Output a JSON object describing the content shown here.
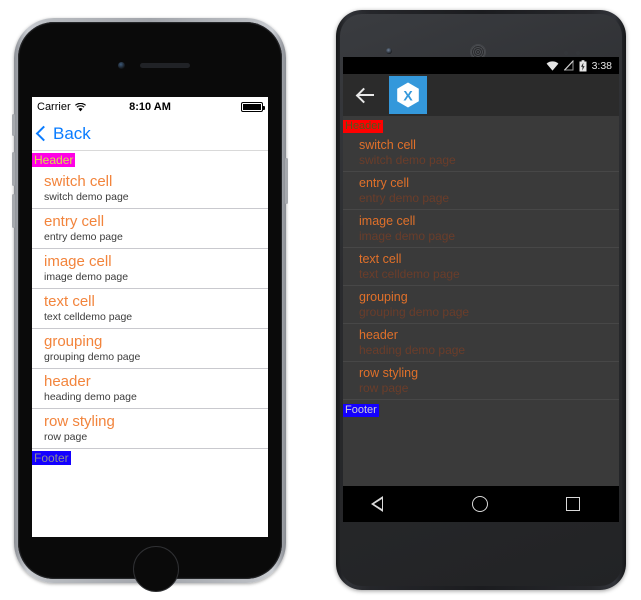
{
  "ios": {
    "status": {
      "carrier": "Carrier",
      "wifi_icon": "wifi-icon",
      "time": "8:10 AM",
      "battery_icon": "battery-icon"
    },
    "nav": {
      "back_label": "Back",
      "back_chevron_icon": "chevron-left-icon"
    },
    "list": {
      "header_label": "Header",
      "footer_label": "Footer",
      "rows": [
        {
          "title": "switch cell",
          "subtitle": "switch demo page"
        },
        {
          "title": "entry cell",
          "subtitle": "entry demo page"
        },
        {
          "title": "image cell",
          "subtitle": "image demo page"
        },
        {
          "title": "text cell",
          "subtitle": "text celldemo page"
        },
        {
          "title": "grouping",
          "subtitle": "grouping demo page"
        },
        {
          "title": "header",
          "subtitle": "heading demo page"
        },
        {
          "title": "row styling",
          "subtitle": "row page"
        }
      ]
    },
    "colors": {
      "header_bg": "#ff00e6",
      "header_text": "#d9e04a",
      "footer_bg": "#1400ff",
      "footer_text": "#8e8e93",
      "title": "#f2843c",
      "tint": "#0a7cff"
    }
  },
  "android": {
    "status": {
      "wifi_icon": "wifi-icon",
      "signal_off_icon": "signal-off-icon",
      "battery_icon": "battery-charging-icon",
      "time": "3:38"
    },
    "actionbar": {
      "back_icon": "arrow-left-icon",
      "logo_icon": "xamarin-logo-icon",
      "logo_letter": "X"
    },
    "list": {
      "header_label": "Header",
      "footer_label": "Footer",
      "rows": [
        {
          "title": "switch cell",
          "subtitle": "switch demo page"
        },
        {
          "title": "entry cell",
          "subtitle": "entry demo page"
        },
        {
          "title": "image cell",
          "subtitle": "image demo page"
        },
        {
          "title": "text cell",
          "subtitle": "text celldemo page"
        },
        {
          "title": "grouping",
          "subtitle": "grouping demo page"
        },
        {
          "title": "header",
          "subtitle": "heading demo page"
        },
        {
          "title": "row styling",
          "subtitle": "row page"
        }
      ]
    },
    "navbar": {
      "back_icon": "nav-back-icon",
      "home_icon": "nav-home-icon",
      "recents_icon": "nav-recents-icon"
    },
    "colors": {
      "header_bg": "#ff0000",
      "header_text": "#4d5b1f",
      "footer_bg": "#1400ff",
      "footer_text": "#cfcfcf",
      "title": "#e0702a",
      "subtitle": "#6b3d2a",
      "brand": "#3498db"
    }
  }
}
